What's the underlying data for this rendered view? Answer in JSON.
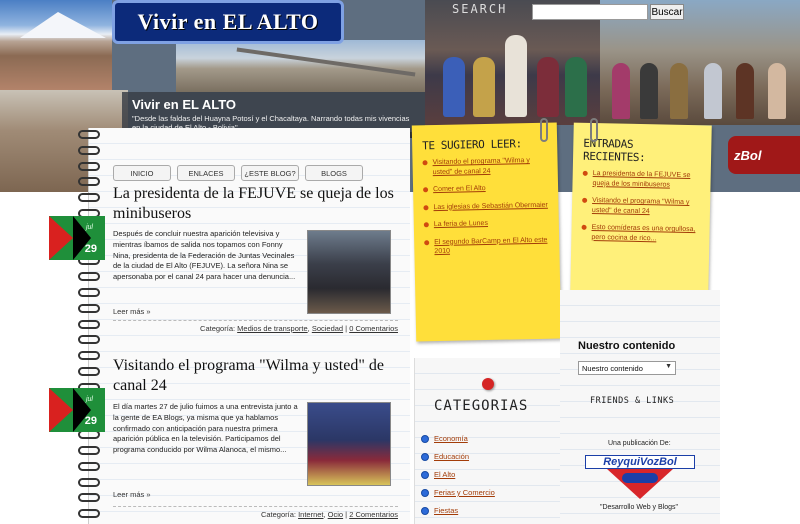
{
  "header": {
    "blog_logo": "Vivir en EL ALTO",
    "subtitle_title": "Vivir en EL ALTO",
    "subtitle_text": "\"Desde las faldas del Huayna Potosí y el Chacaltaya. Narrando todas mis vivencias en la ciudad de El Alto - Bolivia\"",
    "search_label": "SEARCH",
    "search_button": "Buscar",
    "search_value": "",
    "reyqui_corner": "zBol"
  },
  "nav": {
    "items": [
      "INICIO",
      "ENLACES",
      "¿ESTE BLOG?",
      "BLOGS"
    ]
  },
  "posts": [
    {
      "title": "La presidenta de la FEJUVE se queja de los minibuseros",
      "month": "jul",
      "day": "29",
      "body": "Después de concluir nuestra aparición televisiva y mientras íbamos de salida nos topamos con Fonny Nina, presidenta de la Federación de Juntas Vecinales de la ciudad de El Alto (FEJUVE). La señora Nina se apersonaba por el canal 24 para hacer una denuncia...",
      "readmore": "Leer más »",
      "meta_prefix": "Categoría:",
      "categories": [
        "Medios de transporte",
        "Sociedad"
      ],
      "comments": "0 Comentarios"
    },
    {
      "title": "Visitando el programa \"Wilma y usted\" de canal 24",
      "month": "jul",
      "day": "29",
      "body": "El día martes 27 de julio fuimos a una entrevista junto a la gente de EA Blogs, ya misma que ya hablamos confirmado con anticipación para nuestra primera aparición pública en la televisión. Participamos del programa conducido por Wilma Alanoca, el mismo...",
      "readmore": "Leer más »",
      "meta_prefix": "Categoría:",
      "categories": [
        "Internet",
        "Ocio"
      ],
      "comments": "2 Comentarios"
    }
  ],
  "suggest": {
    "heading": "TE SUGIERO LEER:",
    "items": [
      "Visitando el programa \"Wilma y usted\" de canal 24",
      "Comer en El Alto",
      "Las iglesias de Sebastián Obermaier",
      "La feria de Lunes",
      "El segundo BarCamp en El Alto este 2010"
    ]
  },
  "recent": {
    "heading": "ENTRADAS RECIENTES:",
    "items": [
      "La presidenta de la FEJUVE se queja de los minibuseros",
      "Visitando el programa \"Wilma y usted\" de canal 24",
      "Esto comíderas es una orgullosa, pero cocina de rico..."
    ]
  },
  "categorias": {
    "heading": "CATEGORIAS",
    "items": [
      "Economía",
      "Educación",
      "El Alto",
      "Ferias y Comercio",
      "Fiestas"
    ]
  },
  "sidebar_right": {
    "nc_title": "Nuestro contenido",
    "nc_select": "Nuestro contenido",
    "friends": "FRIENDS & LINKS",
    "una_pub": "Una publicación De:",
    "reyqui_logo": "ReyquiVozBol",
    "desarrollo": "\"Desarrollo Web y Blogs\""
  }
}
